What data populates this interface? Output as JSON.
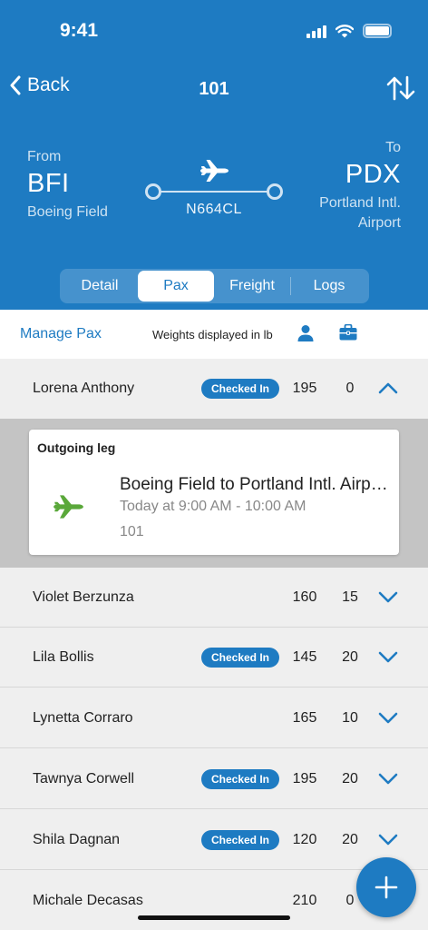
{
  "status": {
    "time": "9:41"
  },
  "nav": {
    "back_label": "Back",
    "title": "101"
  },
  "route": {
    "from_label": "From",
    "from_code": "BFI",
    "from_name": "Boeing Field",
    "to_label": "To",
    "to_code": "PDX",
    "to_name_line1": "Portland Intl.",
    "to_name_line2": "Airport",
    "tail_number": "N664CL"
  },
  "tabs": [
    {
      "label": "Detail",
      "active": false
    },
    {
      "label": "Pax",
      "active": true
    },
    {
      "label": "Freight",
      "active": false
    },
    {
      "label": "Logs",
      "active": false
    }
  ],
  "toolbar": {
    "manage_label": "Manage Pax",
    "weights_note": "Weights displayed in lb"
  },
  "passengers": [
    {
      "name": "Lorena Anthony",
      "status": "Checked In",
      "weight": "195",
      "bags": "0",
      "expanded": true
    },
    {
      "name": "Violet Berzunza",
      "status": "",
      "weight": "160",
      "bags": "15",
      "expanded": false
    },
    {
      "name": "Lila Bollis",
      "status": "Checked In",
      "weight": "145",
      "bags": "20",
      "expanded": false
    },
    {
      "name": "Lynetta Corraro",
      "status": "",
      "weight": "165",
      "bags": "10",
      "expanded": false
    },
    {
      "name": "Tawnya Corwell",
      "status": "Checked In",
      "weight": "195",
      "bags": "20",
      "expanded": false
    },
    {
      "name": "Shila Dagnan",
      "status": "Checked In",
      "weight": "120",
      "bags": "20",
      "expanded": false
    },
    {
      "name": "Michale Decasas",
      "status": "",
      "weight": "210",
      "bags": "0",
      "expanded": false
    }
  ],
  "leg_card": {
    "title": "Outgoing leg",
    "route": "Boeing Field to Portland Intl. Airport",
    "time": "Today at 9:00 AM - 10:00 AM",
    "flight": "101"
  },
  "colors": {
    "brand": "#1e7bc2",
    "plane_green": "#5aa83a"
  },
  "icons": {
    "back": "chevron-left-icon",
    "sort": "sort-arrows-icon",
    "plane": "airplane-icon",
    "person": "person-icon",
    "bag": "briefcase-icon",
    "expand": "chevron-down-icon",
    "collapse": "chevron-up-icon",
    "add": "plus-icon"
  }
}
